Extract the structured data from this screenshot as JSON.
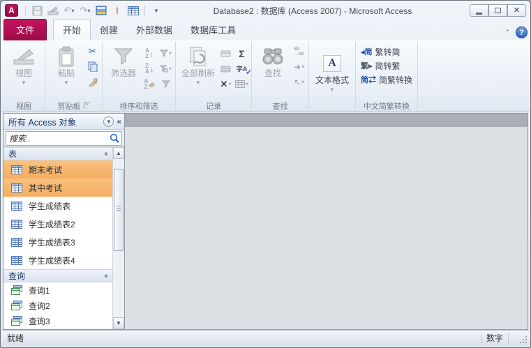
{
  "titlebar": {
    "title": "Database2 : 数据库 (Access 2007) - Microsoft Access"
  },
  "qat": {
    "icons": [
      "access-logo",
      "save",
      "design-view",
      "undo",
      "redo",
      "switch-windows",
      "run",
      "datasheet",
      "customize-quick-access"
    ]
  },
  "tabs": {
    "file": "文件",
    "items": [
      {
        "label": "开始",
        "selected": true
      },
      {
        "label": "创建",
        "selected": false
      },
      {
        "label": "外部数据",
        "selected": false
      },
      {
        "label": "数据库工具",
        "selected": false
      }
    ]
  },
  "ribbon": {
    "views": {
      "button": "视图",
      "label": "视图"
    },
    "clipboard": {
      "button": "粘贴",
      "label": "剪贴板"
    },
    "sort": {
      "button": "筛选器",
      "label": "排序和筛选"
    },
    "records": {
      "button": "全部刷新",
      "label": "记录"
    },
    "find": {
      "button": "查找",
      "label": "查找"
    },
    "textformat": {
      "button": "文本格式"
    },
    "chinese": {
      "items": [
        "繁转简",
        "简转繁",
        "简繁转换"
      ],
      "label": "中文简繁转换"
    }
  },
  "nav": {
    "header": "所有 Access 对象",
    "search_placeholder": "搜索..",
    "sections": [
      {
        "label": "表",
        "items": [
          {
            "label": "期末考试",
            "selected": true
          },
          {
            "label": "其中考试",
            "selected": true
          },
          {
            "label": "学生成绩表",
            "selected": false
          },
          {
            "label": "学生成绩表2",
            "selected": false
          },
          {
            "label": "学生成绩表3",
            "selected": false
          },
          {
            "label": "学生成绩表4",
            "selected": false
          }
        ]
      },
      {
        "label": "查询",
        "items": [
          {
            "label": "查询1",
            "selected": false
          },
          {
            "label": "查询2",
            "selected": false
          },
          {
            "label": "查询3",
            "selected": false
          }
        ]
      }
    ]
  },
  "status": {
    "left": "就绪",
    "num": "数字"
  },
  "colors": {
    "file_tab": "#ad0f52",
    "selection_orange": "#f7b76f",
    "nav_header_text": "#1f3a68"
  }
}
